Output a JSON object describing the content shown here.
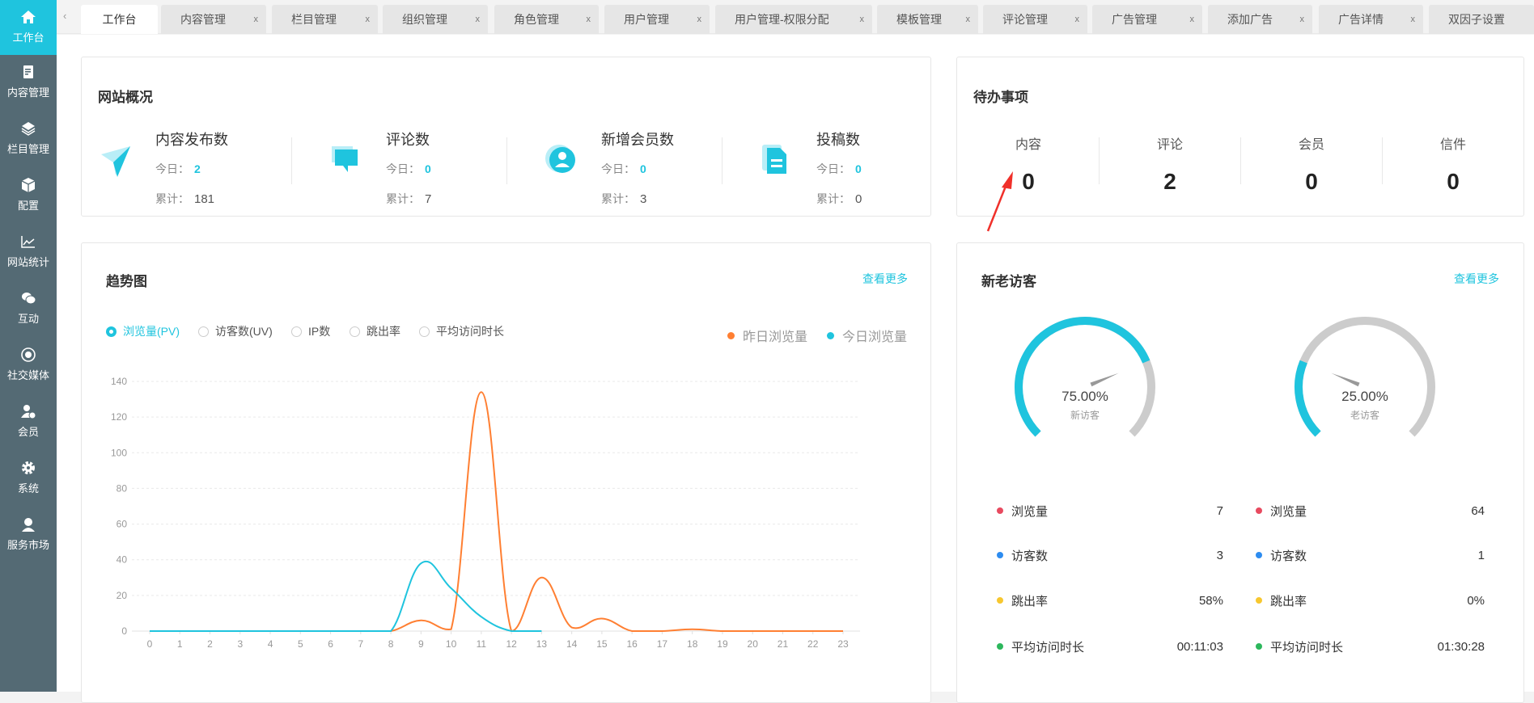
{
  "colors": {
    "accent": "#1fc4de",
    "orange": "#ff7f32",
    "sidebar": "#546a74",
    "gauge_track": "#cccccc",
    "red": "#e84a5f",
    "blue": "#2d8cf0",
    "yellow": "#f7c72f",
    "green": "#2cb75c"
  },
  "sidebar": {
    "items": [
      {
        "label": "工作台",
        "icon": "home-icon"
      },
      {
        "label": "内容管理",
        "icon": "document-icon"
      },
      {
        "label": "栏目管理",
        "icon": "layers-icon"
      },
      {
        "label": "配置",
        "icon": "box-icon"
      },
      {
        "label": "网站统计",
        "icon": "line-chart-icon"
      },
      {
        "label": "互动",
        "icon": "chat-icon"
      },
      {
        "label": "社交媒体",
        "icon": "target-icon"
      },
      {
        "label": "会员",
        "icon": "member-icon"
      },
      {
        "label": "系统",
        "icon": "gear-icon"
      },
      {
        "label": "服务市场",
        "icon": "headset-icon"
      }
    ]
  },
  "tabs": [
    {
      "label": "工作台"
    },
    {
      "label": "内容管理"
    },
    {
      "label": "栏目管理"
    },
    {
      "label": "组织管理"
    },
    {
      "label": "角色管理"
    },
    {
      "label": "用户管理"
    },
    {
      "label": "用户管理-权限分配"
    },
    {
      "label": "模板管理"
    },
    {
      "label": "评论管理"
    },
    {
      "label": "广告管理"
    },
    {
      "label": "添加广告"
    },
    {
      "label": "广告详情"
    },
    {
      "label": "双因子设置"
    }
  ],
  "tab_close": "x",
  "tab_prev": "‹",
  "overview": {
    "title": "网站概况",
    "today_label": "今日：",
    "total_label": "累计：",
    "items": [
      {
        "name": "内容发布数",
        "today": "2",
        "total": "181",
        "icon": "paper-plane-icon"
      },
      {
        "name": "评论数",
        "today": "0",
        "total": "7",
        "icon": "comments-icon"
      },
      {
        "name": "新增会员数",
        "today": "0",
        "total": "3",
        "icon": "user-circle-icon"
      },
      {
        "name": "投稿数",
        "today": "0",
        "total": "0",
        "icon": "file-icon"
      }
    ]
  },
  "todo": {
    "title": "待办事项",
    "items": [
      {
        "label": "内容",
        "value": "0"
      },
      {
        "label": "评论",
        "value": "2"
      },
      {
        "label": "会员",
        "value": "0"
      },
      {
        "label": "信件",
        "value": "0"
      }
    ]
  },
  "trend": {
    "title": "趋势图",
    "more": "查看更多",
    "radios": [
      {
        "label": "浏览量(PV)",
        "checked": true
      },
      {
        "label": "访客数(UV)"
      },
      {
        "label": "IP数"
      },
      {
        "label": "跳出率"
      },
      {
        "label": "平均访问时长"
      }
    ]
  },
  "chart_data": {
    "type": "line",
    "x": [
      "0",
      "1",
      "2",
      "3",
      "4",
      "5",
      "6",
      "7",
      "8",
      "9",
      "10",
      "11",
      "12",
      "13",
      "14",
      "15",
      "16",
      "17",
      "18",
      "19",
      "20",
      "21",
      "22",
      "23"
    ],
    "ylim": [
      0,
      140
    ],
    "yticks": [
      "0",
      "20",
      "40",
      "60",
      "80",
      "100",
      "120",
      "140"
    ],
    "grid": true,
    "legend_position": "top-right",
    "series": [
      {
        "name": "昨日浏览量",
        "color": "#ff7f32",
        "values": [
          0,
          0,
          0,
          0,
          0,
          0,
          0,
          0,
          0,
          6,
          1,
          134,
          0,
          30,
          2,
          7,
          0,
          0,
          1,
          0,
          0,
          0,
          0,
          0
        ]
      },
      {
        "name": "今日浏览量",
        "color": "#1fc4de",
        "values": [
          0,
          0,
          0,
          0,
          0,
          0,
          0,
          0,
          0,
          38,
          24,
          8,
          0,
          0
        ]
      }
    ]
  },
  "visitors": {
    "title": "新老访客",
    "more": "查看更多",
    "gauges": [
      {
        "value": 75,
        "text": "75.00%",
        "label": "新访客"
      },
      {
        "value": 25,
        "text": "25.00%",
        "label": "老访客"
      }
    ],
    "columns": [
      [
        {
          "label": "浏览量",
          "value": "7"
        },
        {
          "label": "访客数",
          "value": "3"
        },
        {
          "label": "跳出率",
          "value": "58%"
        },
        {
          "label": "平均访问时长",
          "value": "00:11:03"
        }
      ],
      [
        {
          "label": "浏览量",
          "value": "64"
        },
        {
          "label": "访客数",
          "value": "1"
        },
        {
          "label": "跳出率",
          "value": "0%"
        },
        {
          "label": "平均访问时长",
          "value": "01:30:28"
        }
      ]
    ]
  }
}
